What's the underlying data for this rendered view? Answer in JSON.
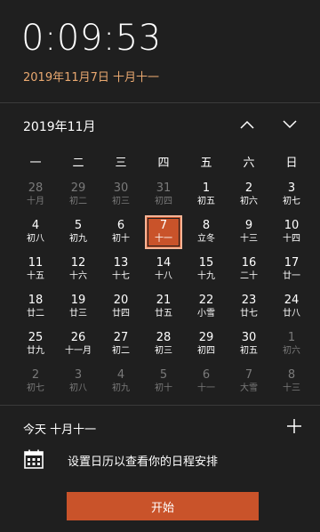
{
  "clock": {
    "time": "0:09:53",
    "date_line": "2019年11月7日 十月十一"
  },
  "calendar": {
    "month_title": "2019年11月",
    "nav": {
      "prev_icon": "chevron-up-icon",
      "next_icon": "chevron-down-icon"
    },
    "weekdays": [
      "一",
      "二",
      "三",
      "四",
      "五",
      "六",
      "日"
    ],
    "weeks": [
      [
        {
          "num": "28",
          "lunar": "十月",
          "other": true
        },
        {
          "num": "29",
          "lunar": "初二",
          "other": true
        },
        {
          "num": "30",
          "lunar": "初三",
          "other": true
        },
        {
          "num": "31",
          "lunar": "初四",
          "other": true
        },
        {
          "num": "1",
          "lunar": "初五",
          "other": false
        },
        {
          "num": "2",
          "lunar": "初六",
          "other": false
        },
        {
          "num": "3",
          "lunar": "初七",
          "other": false
        }
      ],
      [
        {
          "num": "4",
          "lunar": "初八",
          "other": false
        },
        {
          "num": "5",
          "lunar": "初九",
          "other": false
        },
        {
          "num": "6",
          "lunar": "初十",
          "other": false
        },
        {
          "num": "7",
          "lunar": "十一",
          "other": false,
          "today": true
        },
        {
          "num": "8",
          "lunar": "立冬",
          "other": false
        },
        {
          "num": "9",
          "lunar": "十三",
          "other": false
        },
        {
          "num": "10",
          "lunar": "十四",
          "other": false
        }
      ],
      [
        {
          "num": "11",
          "lunar": "十五",
          "other": false
        },
        {
          "num": "12",
          "lunar": "十六",
          "other": false
        },
        {
          "num": "13",
          "lunar": "十七",
          "other": false
        },
        {
          "num": "14",
          "lunar": "十八",
          "other": false
        },
        {
          "num": "15",
          "lunar": "十九",
          "other": false
        },
        {
          "num": "16",
          "lunar": "二十",
          "other": false
        },
        {
          "num": "17",
          "lunar": "廿一",
          "other": false
        }
      ],
      [
        {
          "num": "18",
          "lunar": "廿二",
          "other": false
        },
        {
          "num": "19",
          "lunar": "廿三",
          "other": false
        },
        {
          "num": "20",
          "lunar": "廿四",
          "other": false
        },
        {
          "num": "21",
          "lunar": "廿五",
          "other": false
        },
        {
          "num": "22",
          "lunar": "小雪",
          "other": false
        },
        {
          "num": "23",
          "lunar": "廿七",
          "other": false
        },
        {
          "num": "24",
          "lunar": "廿八",
          "other": false
        }
      ],
      [
        {
          "num": "25",
          "lunar": "廿九",
          "other": false
        },
        {
          "num": "26",
          "lunar": "十一月",
          "other": false
        },
        {
          "num": "27",
          "lunar": "初二",
          "other": false
        },
        {
          "num": "28",
          "lunar": "初三",
          "other": false
        },
        {
          "num": "29",
          "lunar": "初四",
          "other": false
        },
        {
          "num": "30",
          "lunar": "初五",
          "other": false
        },
        {
          "num": "1",
          "lunar": "初六",
          "other": true
        }
      ],
      [
        {
          "num": "2",
          "lunar": "初七",
          "other": true
        },
        {
          "num": "3",
          "lunar": "初八",
          "other": true
        },
        {
          "num": "4",
          "lunar": "初九",
          "other": true
        },
        {
          "num": "5",
          "lunar": "初十",
          "other": true
        },
        {
          "num": "6",
          "lunar": "十一",
          "other": true
        },
        {
          "num": "7",
          "lunar": "大雪",
          "other": true
        },
        {
          "num": "8",
          "lunar": "十三",
          "other": true
        }
      ]
    ]
  },
  "agenda": {
    "today_label": "今天 十月十一",
    "add_icon": "plus-icon",
    "calendar_icon": "calendar-icon",
    "setup_text": "设置日历以查看你的日程安排",
    "start_label": "开始"
  },
  "colors": {
    "accent": "#c9532a",
    "accent_border": "#f3b496",
    "date_text": "#e9a870",
    "background": "#1f1f1f",
    "muted": "#7a7a7a"
  }
}
